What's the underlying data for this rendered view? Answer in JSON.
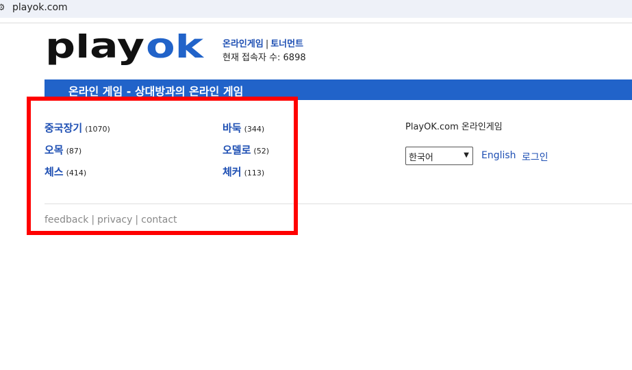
{
  "browser": {
    "url": "playok.com"
  },
  "logo": {
    "part1": "play",
    "part2": "ok"
  },
  "header": {
    "link_online_games": "온라인게임",
    "separator": "|",
    "link_tournament": "토너먼트",
    "online_users": "현재 접속자 수: 6898"
  },
  "banner": {
    "title": "온라인 게임 - 상대방과의 온라인 게임"
  },
  "games": [
    {
      "name": "중국장기",
      "count": "(1070)"
    },
    {
      "name": "바둑",
      "count": "(344)"
    },
    {
      "name": "오목",
      "count": "(87)"
    },
    {
      "name": "오델로",
      "count": "(52)"
    },
    {
      "name": "체스",
      "count": "(414)"
    },
    {
      "name": "체커",
      "count": "(113)"
    }
  ],
  "footer": {
    "feedback": "feedback",
    "privacy": "privacy",
    "contact": "contact",
    "separator": "|"
  },
  "sidebar": {
    "site_name": "PlayOK.com 온라인게임",
    "language_selected": "한국어",
    "english_link": "English",
    "login_link": "로그인"
  },
  "colors": {
    "banner": "#2163c9",
    "link": "#1e4fb3",
    "logo_accent": "#2163c9",
    "highlight": "#ff0000"
  }
}
